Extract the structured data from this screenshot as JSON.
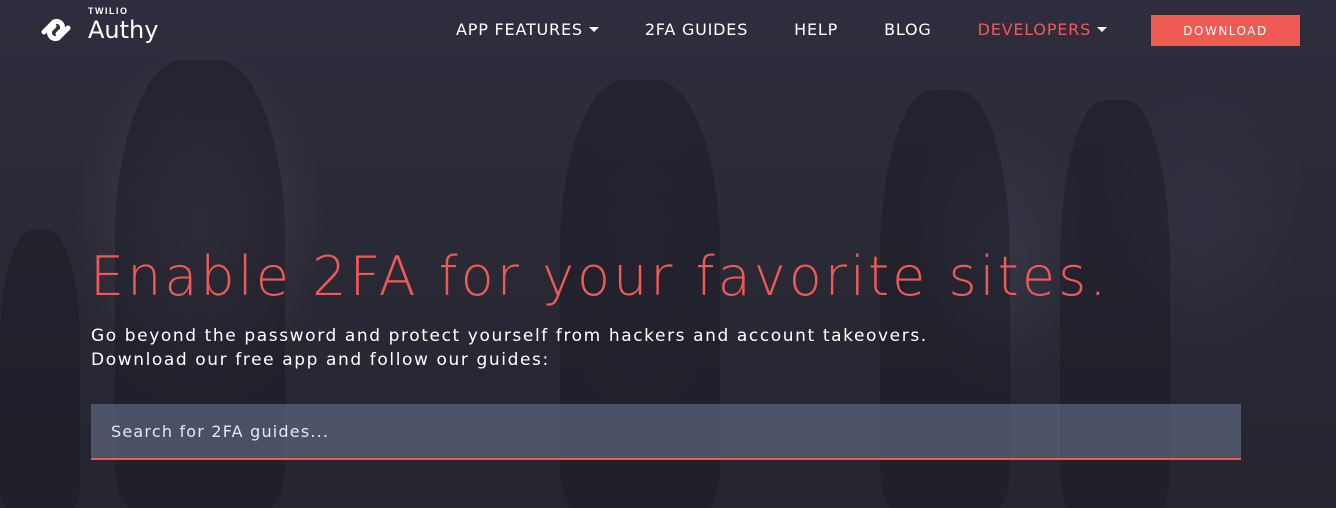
{
  "brand": {
    "company": "TWILIO",
    "product": "Authy",
    "logo_icon": "authy-logo-icon"
  },
  "nav": {
    "items": [
      {
        "label": "APP FEATURES",
        "dropdown": true
      },
      {
        "label": "2FA GUIDES",
        "dropdown": false
      },
      {
        "label": "HELP",
        "dropdown": false
      },
      {
        "label": "BLOG",
        "dropdown": false
      },
      {
        "label": "DEVELOPERS",
        "dropdown": true
      }
    ],
    "download_label": "DOWNLOAD"
  },
  "hero": {
    "headline": "Enable 2FA for your favorite sites.",
    "sub_line_1": "Go beyond the password and protect yourself from hackers and account takeovers.",
    "sub_line_2": "Download our free app and follow our guides:"
  },
  "search": {
    "placeholder": "Search for 2FA guides...",
    "value": ""
  },
  "colors": {
    "accent": "#f05a55",
    "background": "#2a2a38",
    "text": "#ffffff"
  }
}
